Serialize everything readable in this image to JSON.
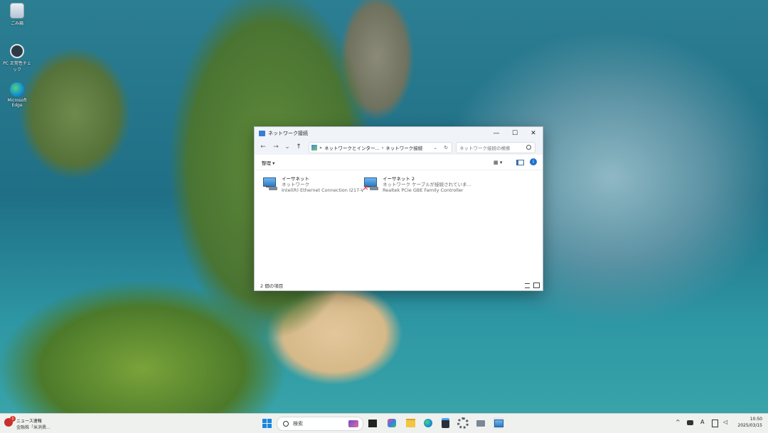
{
  "desktop": {
    "icons": [
      {
        "label": "ごみ箱",
        "icon": "recycle-bin-icon"
      },
      {
        "label": "PC 正常性チェック",
        "icon": "pc-health-check-icon"
      },
      {
        "label": "Microsoft Edge",
        "icon": "edge-icon"
      }
    ]
  },
  "window": {
    "title": "ネットワーク接続",
    "minimize": "—",
    "maximize": "☐",
    "close": "✕",
    "nav": {
      "back": "←",
      "forward": "→",
      "recent": "⌄",
      "up": "↑",
      "breadcrumb_sep0": "«",
      "crumb1": "ネットワークとインター...",
      "breadcrumb_sep1": "›",
      "crumb2": "ネットワーク接続",
      "dropdown": "⌄",
      "refresh": "↻",
      "search_placeholder": "ネットワーク接続の検索"
    },
    "command": {
      "organize": "整理 ▾",
      "view": "▦ ▾",
      "info": "i"
    },
    "adapters": [
      {
        "name": "イーサネット",
        "status": "ネットワーク",
        "device": "Intel(R) Ethernet Connection I217-V",
        "error": false
      },
      {
        "name": "イーサネット 2",
        "status": "ネットワーク ケーブルが接続されていま...",
        "device": "Realtek PCIe GBE Family Controller",
        "error": true
      }
    ],
    "status_bar": "2 個の項目"
  },
  "taskbar": {
    "news_title": "ニュース速報",
    "news_sub": "金融株「米消費...",
    "news_badge": "1",
    "search_label": "検索",
    "clock_time": "10:50",
    "clock_date": "2025/03/15",
    "ime": "A",
    "tray_chevron": "^"
  },
  "colors": {
    "accent": "#0067c0",
    "error": "#d6262e"
  }
}
